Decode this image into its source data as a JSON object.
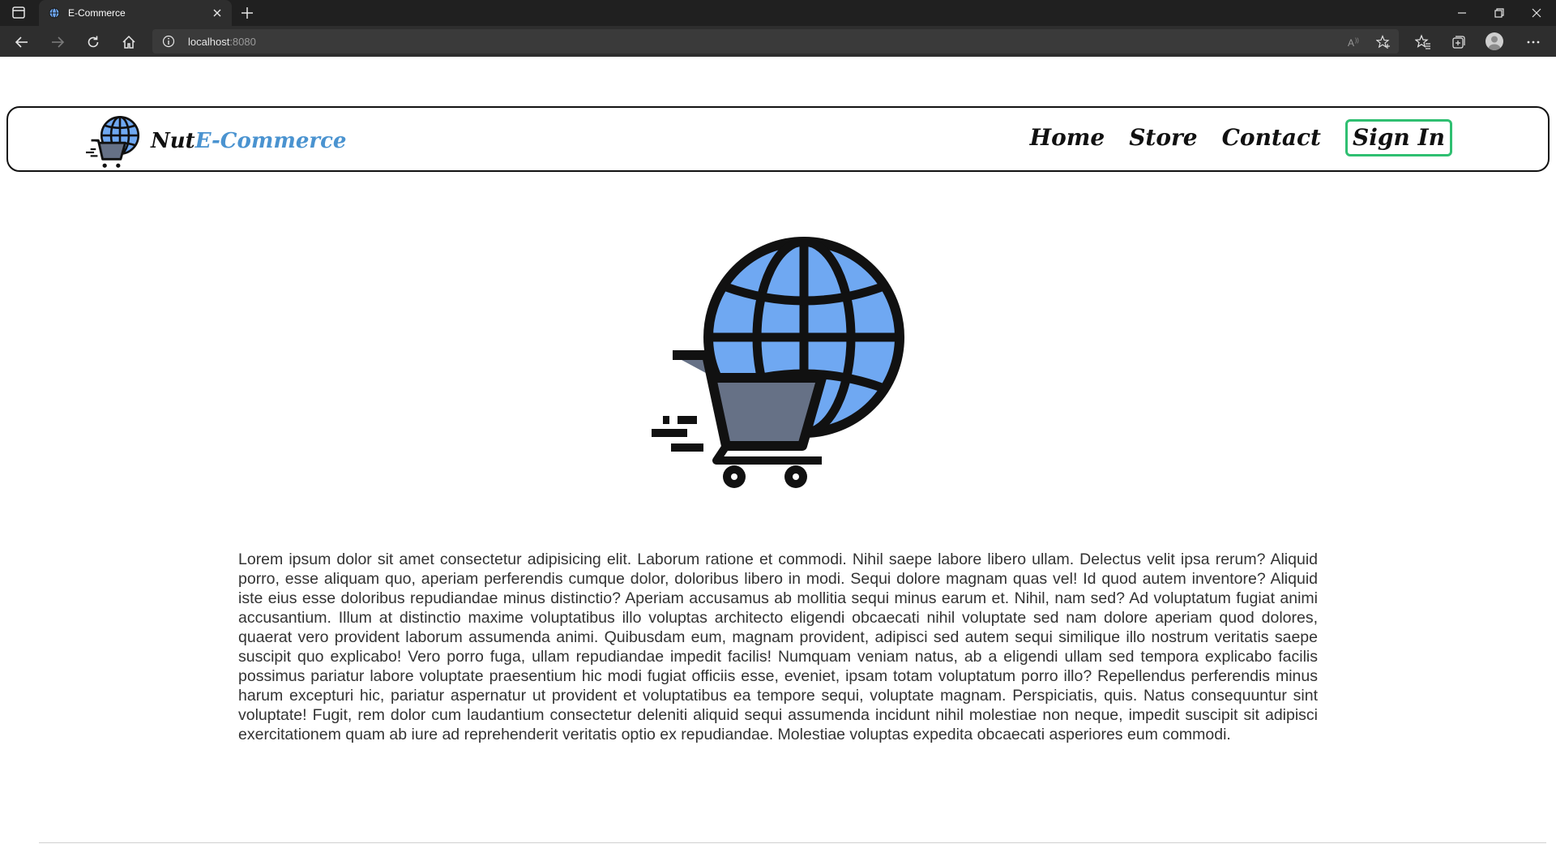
{
  "browser": {
    "tab_title": "E-Commerce",
    "url_host": "localhost",
    "url_port": ":8080",
    "icons": {
      "tab_overview": "tab-overview-icon",
      "favicon": "globe-icon",
      "close": "close-icon",
      "new_tab": "plus-icon",
      "back": "back-arrow-icon",
      "forward": "forward-arrow-icon",
      "reload": "reload-icon",
      "home": "home-icon",
      "info": "info-icon",
      "read_aloud": "read-aloud-icon",
      "add_favorite": "star-plus-icon",
      "favorites": "favorites-icon",
      "collections": "collections-icon",
      "profile": "profile-icon",
      "more": "more-icon"
    }
  },
  "navbar": {
    "brand_part1": "Nut",
    "brand_part2": "E-Commerce",
    "links": [
      "Home",
      "Store",
      "Contact"
    ],
    "signin_label": "Sign In",
    "signin_color": "#2fbf71",
    "brand_accent": "#4a93d0"
  },
  "main": {
    "paragraph": "Lorem ipsum dolor sit amet consectetur adipisicing elit. Laborum ratione et commodi. Nihil saepe labore libero ullam. Delectus velit ipsa rerum? Aliquid porro, esse aliquam quo, aperiam perferendis cumque dolor, doloribus libero in modi. Sequi dolore magnam quas vel! Id quod autem inventore? Aliquid iste eius esse doloribus repudiandae minus distinctio? Aperiam accusamus ab mollitia sequi minus earum et. Nihil, nam sed? Ad voluptatum fugiat animi accusantium. Illum at distinctio maxime voluptatibus illo voluptas architecto eligendi obcaecati nihil voluptate sed nam dolore aperiam quod dolores, quaerat vero provident laborum assumenda animi. Quibusdam eum, magnam provident, adipisci sed autem sequi similique illo nostrum veritatis saepe suscipit quo explicabo! Vero porro fuga, ullam repudiandae impedit facilis! Numquam veniam natus, ab a eligendi ullam sed tempora explicabo facilis possimus pariatur labore voluptate praesentium hic modi fugiat officiis esse, eveniet, ipsam totam voluptatum porro illo? Repellendus perferendis minus harum excepturi hic, pariatur aspernatur ut provident et voluptatibus ea tempore sequi, voluptate magnam. Perspiciatis, quis. Natus consequuntur sint voluptate! Fugit, rem dolor cum laudantium consectetur deleniti aliquid sequi assumenda incidunt nihil molestiae non neque, impedit suscipit sit adipisci exercitationem quam ab iure ad reprehenderit veritatis optio ex repudiandae. Molestiae voluptas expedita obcaecati asperiores eum commodi.",
    "hero_icon": "globe-cart-icon",
    "globe_color": "#6fa8f2",
    "cart_color": "#667186"
  }
}
